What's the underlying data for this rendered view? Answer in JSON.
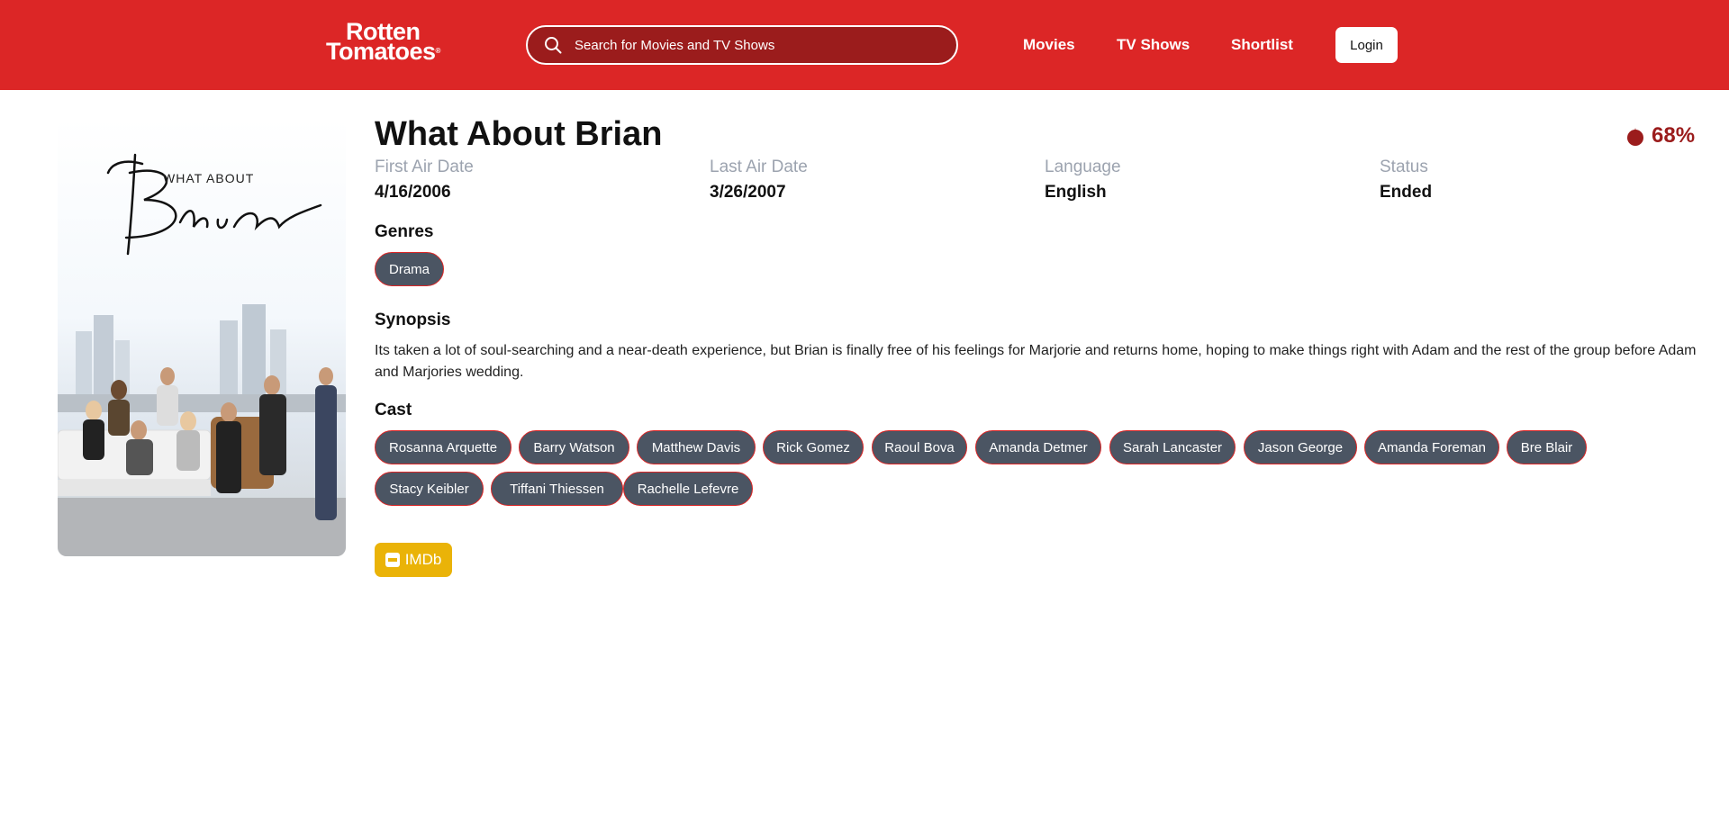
{
  "header": {
    "logo_line1": "Rotten",
    "logo_line2": "Tomatoes",
    "search_placeholder": "Search for Movies and TV Shows",
    "nav": [
      "Movies",
      "TV Shows",
      "Shortlist"
    ],
    "login_label": "Login"
  },
  "poster": {
    "small_text": "WHAT ABOUT",
    "script_text": "Brian"
  },
  "show": {
    "title": "What About Brian",
    "score": "68%",
    "first_air_label": "First Air Date",
    "first_air_value": "4/16/2006",
    "last_air_label": "Last Air Date",
    "last_air_value": "3/26/2007",
    "language_label": "Language",
    "language_value": "English",
    "status_label": "Status",
    "status_value": "Ended",
    "genres_heading": "Genres",
    "genres": [
      "Drama"
    ],
    "synopsis_heading": "Synopsis",
    "synopsis": "Its taken a lot of soul-searching and a near-death experience, but Brian is finally free of his feelings for Marjorie and returns home, hoping to make things right with Adam and the rest of the group before Adam and Marjories wedding.",
    "cast_heading": "Cast",
    "cast": [
      "Rosanna Arquette",
      "Barry Watson",
      "Matthew Davis",
      "Rick Gomez",
      "Raoul Bova",
      "Amanda Detmer",
      "Sarah Lancaster",
      "Jason George",
      "Amanda Foreman",
      "Bre Blair",
      "Stacy Keibler",
      "Tiffani Thiessen",
      "Rachelle Lefevre"
    ],
    "imdb_label": "IMDb"
  },
  "colors": {
    "brand_red": "#dc2626",
    "chip_gray": "#4b5563",
    "imdb_yellow": "#eab308",
    "score_red": "#9b1c1c"
  }
}
